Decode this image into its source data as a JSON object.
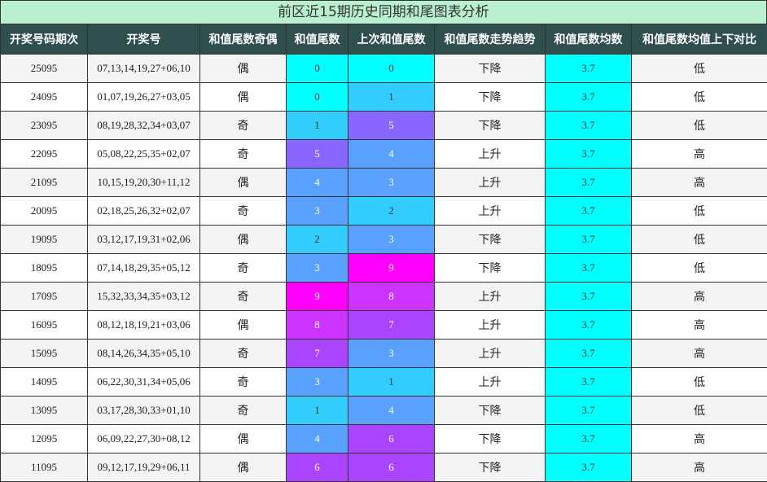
{
  "title": "前区近15期历史同期和尾图表分析",
  "colors": {
    "header_bg": "#2f4f4f",
    "title_bg": "#b8f0d0",
    "avg_bg": "#00ffff",
    "tail_0": "#00ffff",
    "tail_1": "#33ccff",
    "tail_2": "#33ccff",
    "tail_3": "#5aa0ff",
    "tail_4": "#5aa0ff",
    "tail_5": "#8866ff",
    "tail_6": "#aa44ff",
    "tail_7": "#aa44ff",
    "tail_8": "#cc33ff",
    "tail_9": "#ff00ff"
  },
  "chart_data": {
    "type": "table",
    "title": "前区近15期历史同期和尾图表分析",
    "columns": [
      "开奖号码期次",
      "开奖号",
      "和值尾数奇偶",
      "和值尾数",
      "上次和值尾数",
      "和值尾数走势趋势",
      "和值尾数均数",
      "和值尾数均值上下对比"
    ],
    "rows": [
      {
        "period": "25095",
        "numbers": "07,13,14,19,27+06,10",
        "parity": "偶",
        "tail": 0,
        "prev_tail": 0,
        "trend": "下降",
        "avg": "3.7",
        "compare": "低"
      },
      {
        "period": "24095",
        "numbers": "01,07,19,26,27+03,05",
        "parity": "偶",
        "tail": 0,
        "prev_tail": 1,
        "trend": "下降",
        "avg": "3.7",
        "compare": "低"
      },
      {
        "period": "23095",
        "numbers": "08,19,28,32,34+03,07",
        "parity": "奇",
        "tail": 1,
        "prev_tail": 5,
        "trend": "下降",
        "avg": "3.7",
        "compare": "低"
      },
      {
        "period": "22095",
        "numbers": "05,08,22,25,35+02,07",
        "parity": "奇",
        "tail": 5,
        "prev_tail": 4,
        "trend": "上升",
        "avg": "3.7",
        "compare": "高"
      },
      {
        "period": "21095",
        "numbers": "10,15,19,20,30+11,12",
        "parity": "偶",
        "tail": 4,
        "prev_tail": 3,
        "trend": "上升",
        "avg": "3.7",
        "compare": "高"
      },
      {
        "period": "20095",
        "numbers": "02,18,25,26,32+02,07",
        "parity": "奇",
        "tail": 3,
        "prev_tail": 2,
        "trend": "上升",
        "avg": "3.7",
        "compare": "低"
      },
      {
        "period": "19095",
        "numbers": "03,12,17,19,31+02,06",
        "parity": "偶",
        "tail": 2,
        "prev_tail": 3,
        "trend": "下降",
        "avg": "3.7",
        "compare": "低"
      },
      {
        "period": "18095",
        "numbers": "07,14,18,29,35+05,12",
        "parity": "奇",
        "tail": 3,
        "prev_tail": 9,
        "trend": "下降",
        "avg": "3.7",
        "compare": "低"
      },
      {
        "period": "17095",
        "numbers": "15,32,33,34,35+03,12",
        "parity": "奇",
        "tail": 9,
        "prev_tail": 8,
        "trend": "上升",
        "avg": "3.7",
        "compare": "高"
      },
      {
        "period": "16095",
        "numbers": "08,12,18,19,21+03,06",
        "parity": "偶",
        "tail": 8,
        "prev_tail": 7,
        "trend": "上升",
        "avg": "3.7",
        "compare": "高"
      },
      {
        "period": "15095",
        "numbers": "08,14,26,34,35+05,10",
        "parity": "奇",
        "tail": 7,
        "prev_tail": 3,
        "trend": "上升",
        "avg": "3.7",
        "compare": "高"
      },
      {
        "period": "14095",
        "numbers": "06,22,30,31,34+05,06",
        "parity": "奇",
        "tail": 3,
        "prev_tail": 1,
        "trend": "上升",
        "avg": "3.7",
        "compare": "低"
      },
      {
        "period": "13095",
        "numbers": "03,17,28,30,33+01,10",
        "parity": "奇",
        "tail": 1,
        "prev_tail": 4,
        "trend": "下降",
        "avg": "3.7",
        "compare": "低"
      },
      {
        "period": "12095",
        "numbers": "06,09,22,27,30+08,12",
        "parity": "偶",
        "tail": 4,
        "prev_tail": 6,
        "trend": "下降",
        "avg": "3.7",
        "compare": "高"
      },
      {
        "period": "11095",
        "numbers": "09,12,17,19,29+06,11",
        "parity": "偶",
        "tail": 6,
        "prev_tail": 6,
        "trend": "下降",
        "avg": "3.7",
        "compare": "高"
      }
    ]
  }
}
